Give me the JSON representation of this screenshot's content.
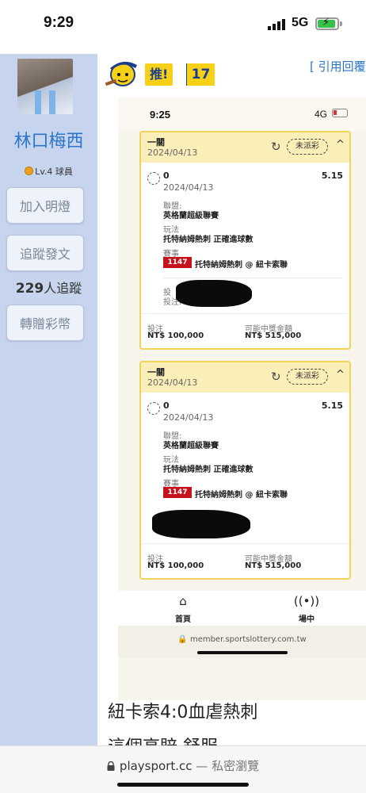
{
  "status_bar": {
    "time": "9:29",
    "network": "5G"
  },
  "sidebar": {
    "username": "林口梅西",
    "level": "Lv.4 球員",
    "buttons": {
      "lantern": "加入明燈",
      "follow_post": "追蹤發文",
      "gift": "轉贈彩幣"
    },
    "followers_count": "229",
    "followers_suffix": "人追蹤"
  },
  "main": {
    "push_label": "推!",
    "push_count": "17",
    "quote_link": "[ 引用回覆",
    "post_title": "紐卡索4:0血虐熱刺",
    "post_line2": "這個高賠 舒服"
  },
  "screenshot": {
    "time": "9:25",
    "network": "4G",
    "cards": [
      {
        "type": "一關",
        "date": "2024/04/13",
        "status": "未派彩",
        "pick": "0",
        "pick_date": "2024/04/13",
        "odds": "5.15",
        "league_label": "聯盟:",
        "league": "英格蘭超級聯賽",
        "play_label": "玩法",
        "play": "托特納姆熱刺 正確進球數",
        "event_label": "賽事",
        "match_id": "1147",
        "match": "托特納姆熱刺 @ 紐卡索聯",
        "hidden_label_1": "投",
        "hidden_label_2": "投注I",
        "stake_label": "投注",
        "stake": "NT$ 100,000",
        "payout_label": "可能中獎金額",
        "payout": "NT$ 515,000"
      },
      {
        "type": "一關",
        "date": "2024/04/13",
        "status": "未派彩",
        "pick": "0",
        "pick_date": "2024/04/13",
        "odds": "5.15",
        "league_label": "聯盟:",
        "league": "英格蘭超級聯賽",
        "play_label": "玩法",
        "play": "托特納姆熱刺 正確進球數",
        "event_label": "賽事",
        "match_id": "1147",
        "match": "托特納姆熱刺 @ 紐卡索聯",
        "stake_label": "投注",
        "stake": "NT$ 100,000",
        "payout_label": "可能中獎金額",
        "payout": "NT$ 515,000"
      }
    ],
    "nav": {
      "home": "首頁",
      "live": "場中"
    },
    "url": "member.sportslottery.com.tw"
  },
  "browser": {
    "url": "playsport.cc",
    "private": "— 私密瀏覽"
  },
  "colors": {
    "sidebar_bg": "#c6d4ee",
    "username": "#2b76c9",
    "card_border": "#f1d35a",
    "card_head": "#fbefb9",
    "match_badge": "#c5121d"
  }
}
